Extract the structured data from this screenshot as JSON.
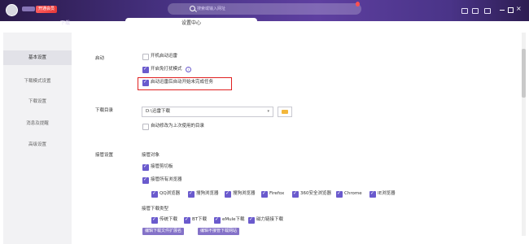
{
  "topbar": {
    "vip_badge": "开通会员",
    "search_placeholder": "搜索或输入网址"
  },
  "tabs": [
    {
      "label": "下载"
    },
    {
      "label": "设置中心"
    }
  ],
  "sidebar": {
    "items": [
      {
        "label": "基本设置"
      },
      {
        "label": "下载模式设置"
      },
      {
        "label": "下载设置"
      },
      {
        "label": "消息及提醒"
      },
      {
        "label": "高级设置"
      }
    ]
  },
  "startup": {
    "label": "启动",
    "options": [
      {
        "label": "开机启动迅雷",
        "checked": false
      },
      {
        "label": "开启免打扰模式",
        "checked": true
      },
      {
        "label": "启动迅雷后自动开始未完成任务",
        "checked": true
      }
    ]
  },
  "download_dir": {
    "label": "下载目录",
    "value": "D:\\迅雷下载",
    "remember_label": "自动修改为上次使用的目录",
    "remember_checked": false
  },
  "takeover": {
    "label": "接管设置",
    "objects_title": "接管对象",
    "clipboard_label": "接管剪切板",
    "browsers_label": "接管所有浏览器",
    "browsers": [
      {
        "label": "QQ浏览器"
      },
      {
        "label": "搜狗浏览器"
      },
      {
        "label": "搜狗浏览器"
      },
      {
        "label": "Firefox"
      },
      {
        "label": "360安全浏览器"
      },
      {
        "label": "Chrome"
      },
      {
        "label": "IE浏览器"
      }
    ],
    "types_title": "接管下载类型",
    "types": [
      {
        "label": "传统下载"
      },
      {
        "label": "BT下载"
      },
      {
        "label": "eMule下载"
      },
      {
        "label": "磁力链接下载"
      }
    ],
    "btn_extensions": "编辑下载文件扩展名",
    "btn_exclude": "编辑不接管下载网站"
  },
  "colors": {
    "accent": "#6a5acd",
    "highlight": "#e02020",
    "topbar": "#4a3488"
  }
}
